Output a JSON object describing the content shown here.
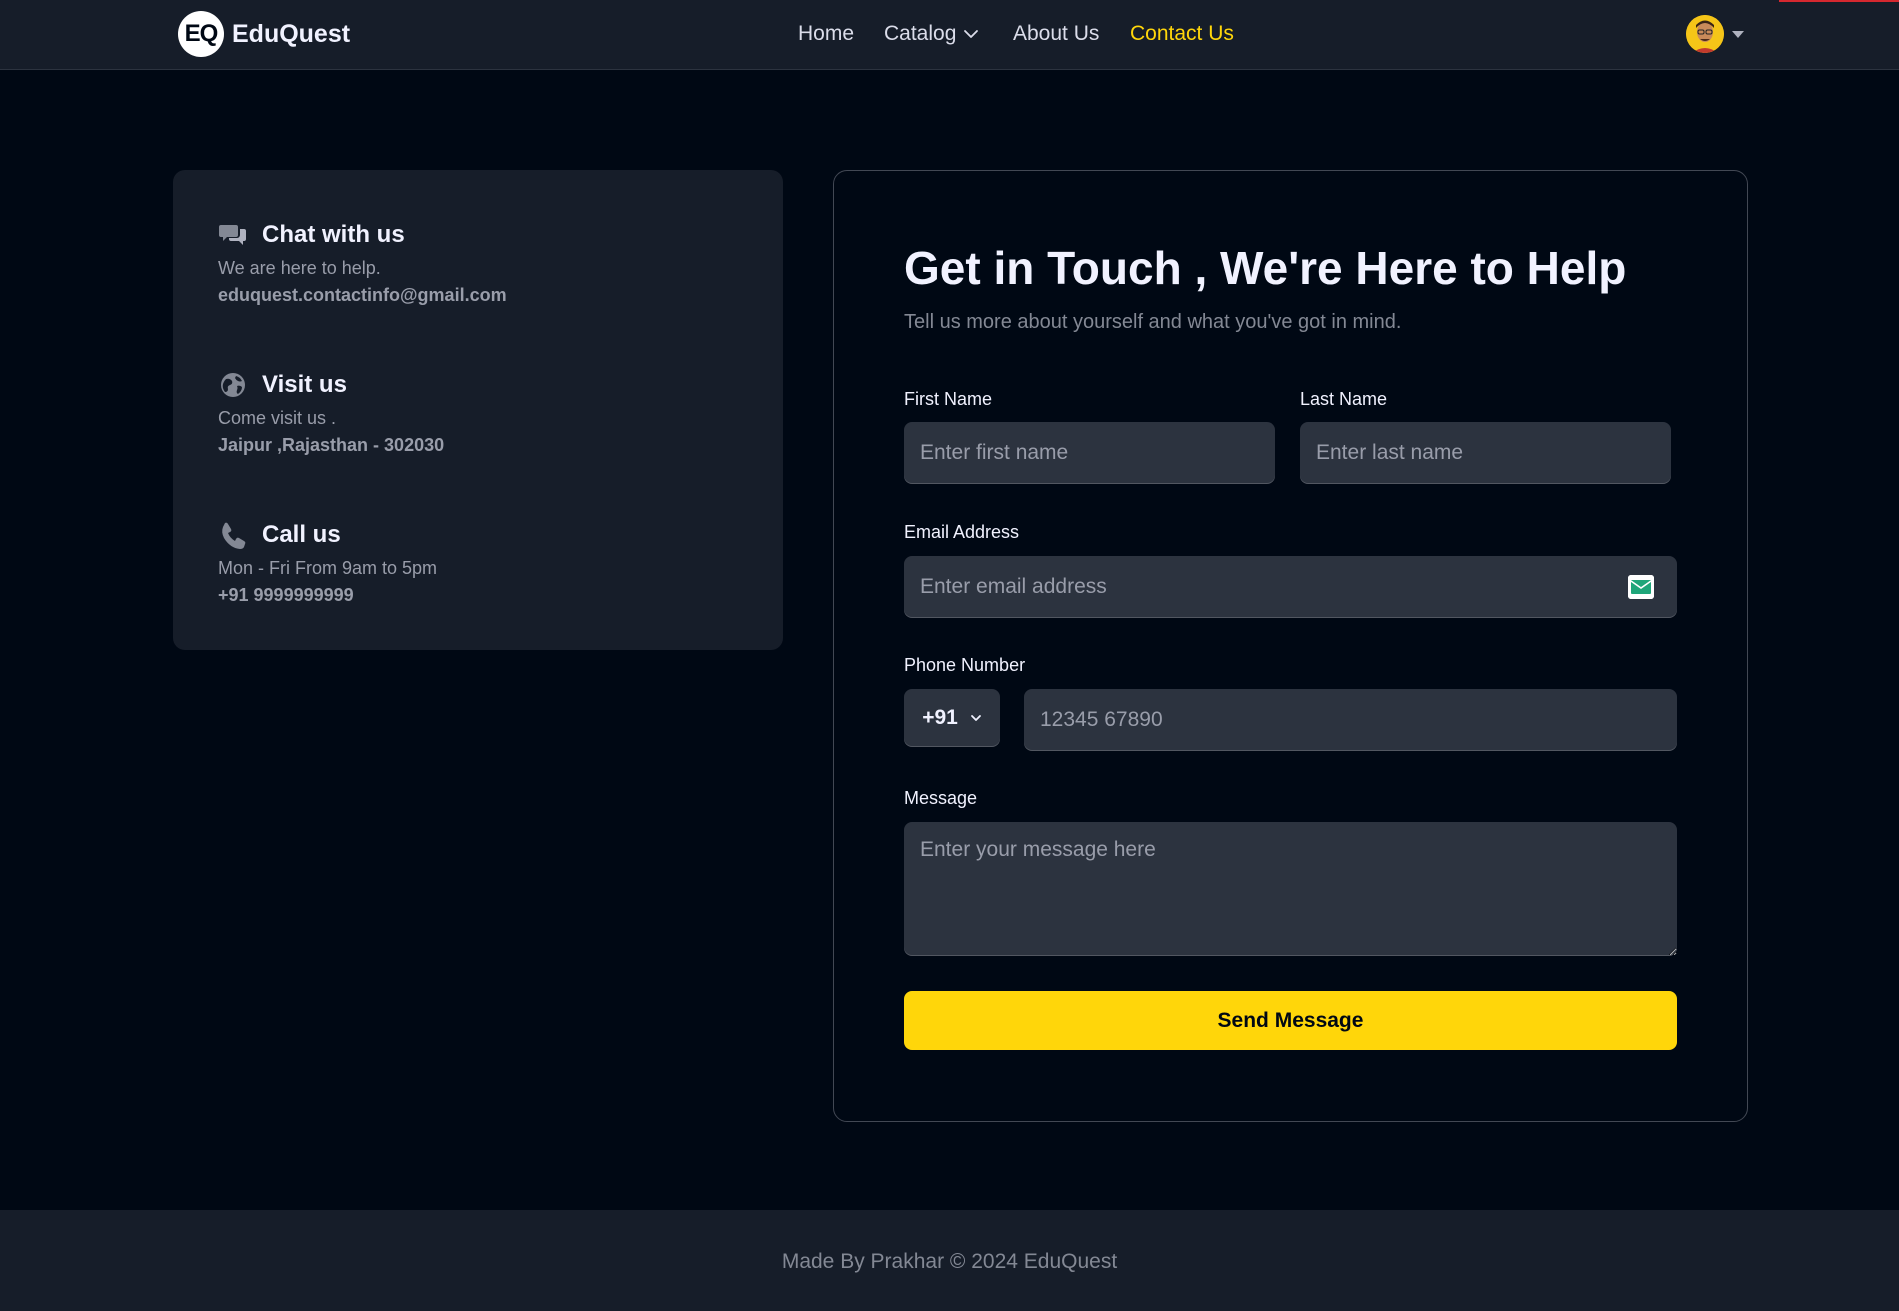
{
  "navbar": {
    "brand_mark": "EQ",
    "brand_name": "EduQuest",
    "links": [
      {
        "label": "Home"
      },
      {
        "label": "Catalog"
      },
      {
        "label": "About Us"
      },
      {
        "label": "Contact Us",
        "active": true
      }
    ],
    "active_color": "#FFD60A"
  },
  "contact_info": [
    {
      "icon": "chat-bubbles-icon",
      "title": "Chat with us",
      "description": "We are here to help.",
      "detail": "eduquest.contactinfo@gmail.com"
    },
    {
      "icon": "globe-icon",
      "title": "Visit us",
      "description": "Come visit us .",
      "detail": "Jaipur ,Rajasthan - 302030"
    },
    {
      "icon": "phone-icon",
      "title": "Call us",
      "description": "Mon - Fri From 9am to 5pm",
      "detail": "+91 9999999999"
    }
  ],
  "form": {
    "title": "Get in Touch , We're Here to Help",
    "subtitle": "Tell us more about yourself and what you've got in mind.",
    "first_name": {
      "label": "First Name",
      "placeholder": "Enter first name"
    },
    "last_name": {
      "label": "Last Name",
      "placeholder": "Enter last name"
    },
    "email": {
      "label": "Email Address",
      "placeholder": "Enter email address"
    },
    "phone": {
      "label": "Phone Number",
      "country_code": "+91",
      "placeholder": "12345 67890"
    },
    "message": {
      "label": "Message",
      "placeholder": "Enter your message here"
    },
    "submit_label": "Send Message",
    "submit_color": "#FFD60A"
  },
  "footer": {
    "text": "Made By Prakhar © 2024 EduQuest"
  }
}
